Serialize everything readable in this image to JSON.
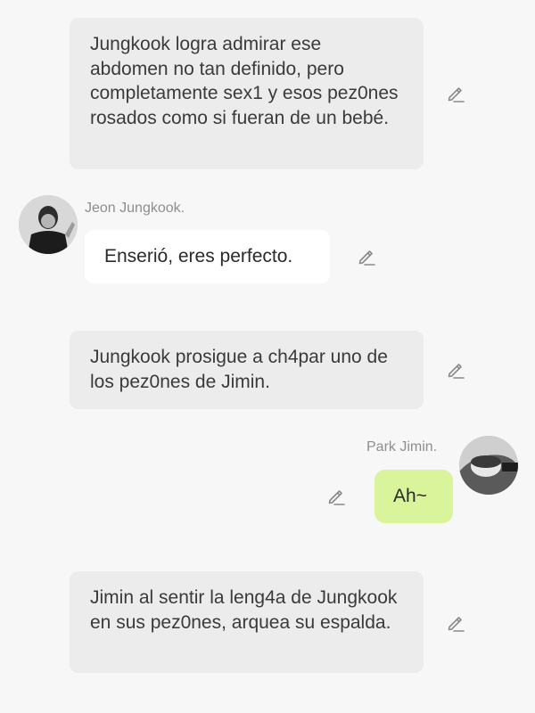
{
  "messages": [
    {
      "type": "narration",
      "text": "Jungkook logra admirar ese abdomen no tan definido, pero completamente sex1 y esos pez0nes rosados como si fueran de un bebé."
    },
    {
      "type": "character-left",
      "name": "Jeon Jungkook.",
      "text": "Enserió, eres perfecto."
    },
    {
      "type": "narration",
      "text": "Jungkook prosigue a ch4par uno de los pez0nes de Jimin."
    },
    {
      "type": "character-right",
      "name": "Park Jimin.",
      "text": "Ah~"
    },
    {
      "type": "narration",
      "text": "Jimin al sentir la leng4a de Jungkook en sus pez0nes, arquea su espalda."
    }
  ],
  "icons": {
    "edit": "pencil-edit-icon"
  },
  "colors": {
    "background": "#f7f7f7",
    "narration_bubble": "#ececec",
    "left_bubble": "#ffffff",
    "right_bubble": "#d9f49a",
    "name_text": "#8e8e8e",
    "icon": "#8a8a8a"
  }
}
